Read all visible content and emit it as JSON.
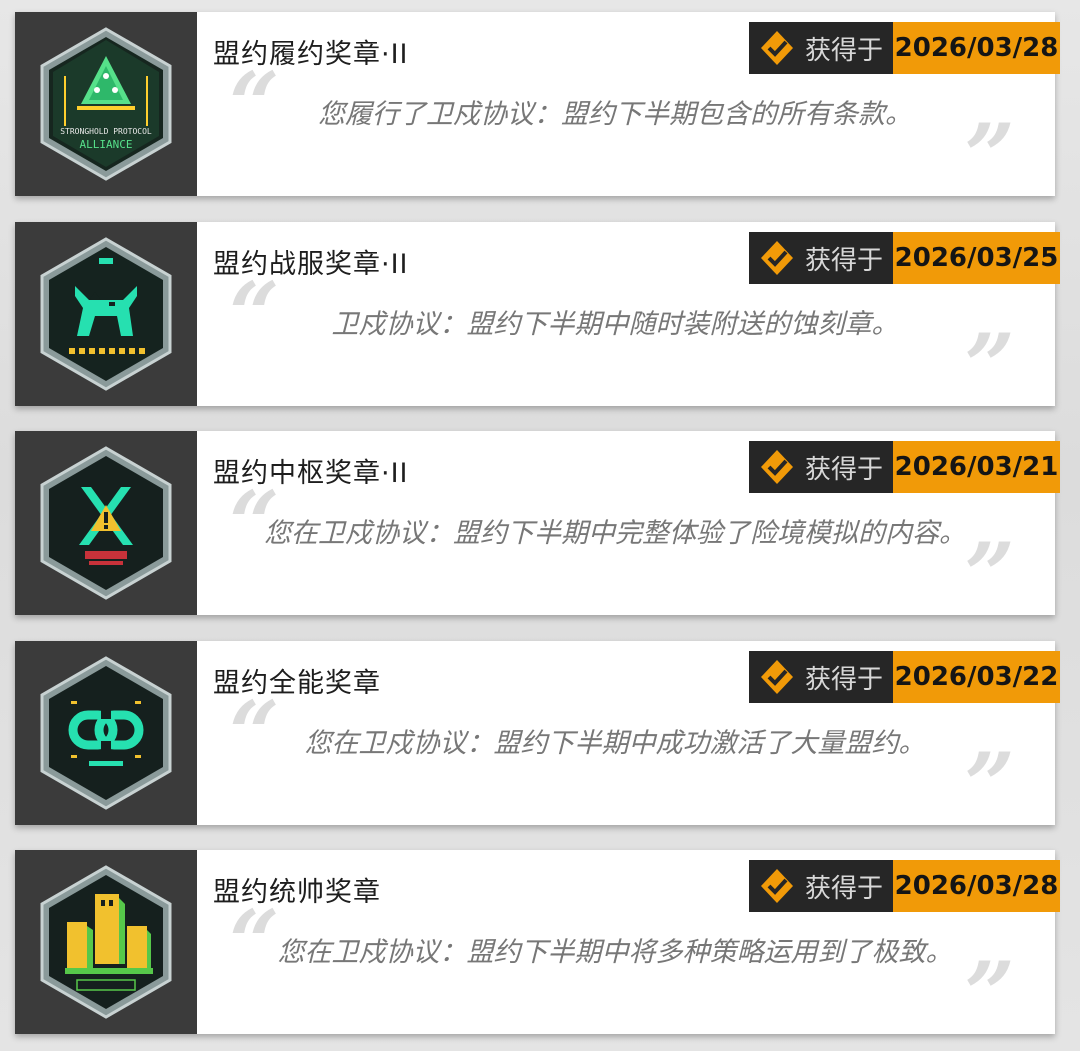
{
  "obtained_label": "获得于",
  "medals": [
    {
      "title": "盟约履约奖章·II",
      "date": "2026/03/28",
      "description": "您履行了卫戍协议：盟约下半期包含的所有条款。",
      "icon": "stronghold-protocol-alliance-badge",
      "badge_text": [
        "STRONGHOLD PROTOCOL",
        "ALLIANCE"
      ]
    },
    {
      "title": "盟约战服奖章·II",
      "date": "2026/03/25",
      "description": "卫戍协议：盟约下半期中随时装附送的蚀刻章。",
      "icon": "wolf-badge"
    },
    {
      "title": "盟约中枢奖章·II",
      "date": "2026/03/21",
      "description": "您在卫戍协议：盟约下半期中完整体验了险境模拟的内容。",
      "icon": "crossed-swords-warning-badge"
    },
    {
      "title": "盟约全能奖章",
      "date": "2026/03/22",
      "description": "您在卫戍协议：盟约下半期中成功激活了大量盟约。",
      "icon": "chain-link-badge"
    },
    {
      "title": "盟约统帅奖章",
      "date": "2026/03/28",
      "description": "您在卫戍协议：盟约下半期中将多种策略运用到了极致。",
      "icon": "fortress-badge"
    }
  ],
  "colors": {
    "accent": "#f19a08",
    "dark": "#262626",
    "panel": "#3b3b3b",
    "neon": "#26e0b0"
  }
}
